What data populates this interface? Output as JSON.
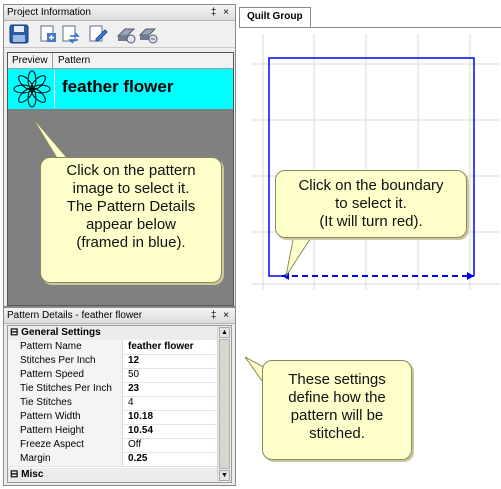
{
  "project_panel": {
    "title": "Project Information",
    "pin_close": "‡ ×",
    "toolbar": [
      "save-icon",
      "add-pattern-icon",
      "replace-pattern-icon",
      "edit-pattern-icon",
      "print-icon",
      "group-print-icon"
    ],
    "columns": [
      "Preview",
      "Pattern"
    ],
    "pattern_name": "feather flower"
  },
  "callout_pattern": [
    "Click on the pattern",
    "image to select it.",
    "The Pattern Details",
    "appear below",
    "(framed in blue)."
  ],
  "quilt": {
    "tab_label": "Quilt Group",
    "callout": [
      "Click on the boundary",
      "to select it.",
      "(It will turn red)."
    ],
    "boundary_color": "#0000ff"
  },
  "details_panel": {
    "title": "Pattern Details - feather flower",
    "pin_close": "‡ ×",
    "group_general": "General Settings",
    "group_misc": "Misc",
    "expander_open": "⊟",
    "rows": [
      {
        "name": "Pattern Name",
        "value": "feather flower"
      },
      {
        "name": "Stitches Per Inch",
        "value": "12"
      },
      {
        "name": "Pattern Speed",
        "value": "50"
      },
      {
        "name": "Tie Stitches Per Inch",
        "value": "23"
      },
      {
        "name": "Tie Stitches",
        "value": "4"
      },
      {
        "name": "Pattern Width",
        "value": "10.18"
      },
      {
        "name": "Pattern Height",
        "value": "10.54"
      },
      {
        "name": "Freeze Aspect",
        "value": "Off"
      },
      {
        "name": "Margin",
        "value": "0.25"
      }
    ]
  },
  "callout_settings": [
    "These settings",
    "define how the",
    "pattern will be",
    "stitched."
  ]
}
